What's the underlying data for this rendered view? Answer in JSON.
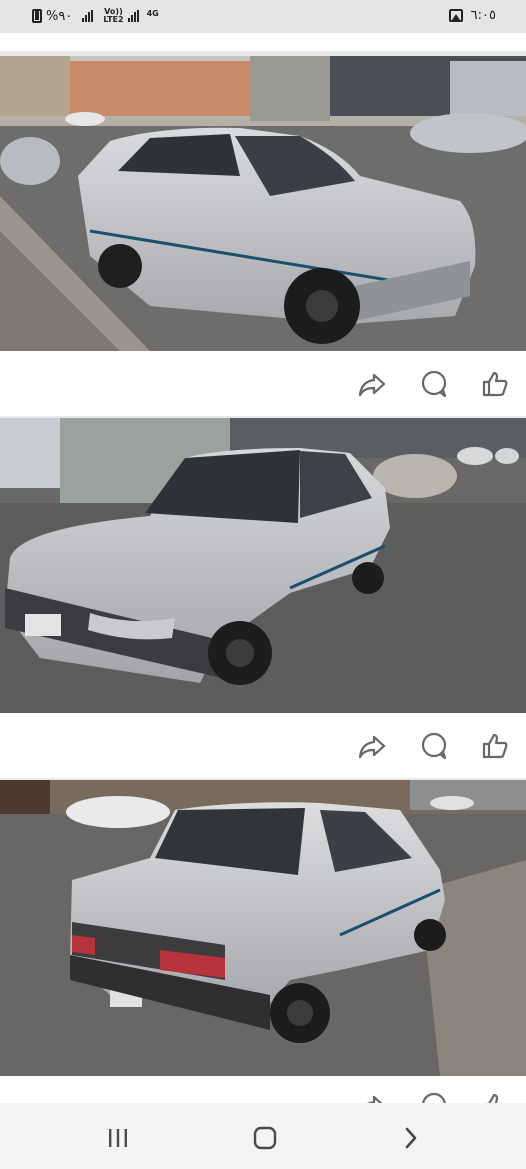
{
  "status_bar": {
    "battery_percent": "%٩٠",
    "carrier_top": "Vo))",
    "carrier_bottom": "LTE2",
    "network": "4G",
    "time": "٦:٠٥"
  },
  "icons": {
    "battery": "battery-icon",
    "signal": "signal-icon",
    "gallery": "gallery-icon",
    "share": "share-icon",
    "comment": "comment-icon",
    "like": "like-icon",
    "recents": "recents-icon",
    "home": "home-icon",
    "back": "back-icon"
  },
  "posts": [
    {
      "photo_name": "car-photo-front-left",
      "subject": "silver sedan parked on curb"
    },
    {
      "photo_name": "car-photo-front",
      "subject": "silver sedan parked on street"
    },
    {
      "photo_name": "car-photo-rear",
      "subject": "silver sedan rear view"
    }
  ],
  "colors": {
    "status_bar_bg": "#e4e5e7",
    "separator": "#e8e9eb",
    "icon": "#65676b",
    "nav_bar_bg": "#f3f4f6"
  }
}
